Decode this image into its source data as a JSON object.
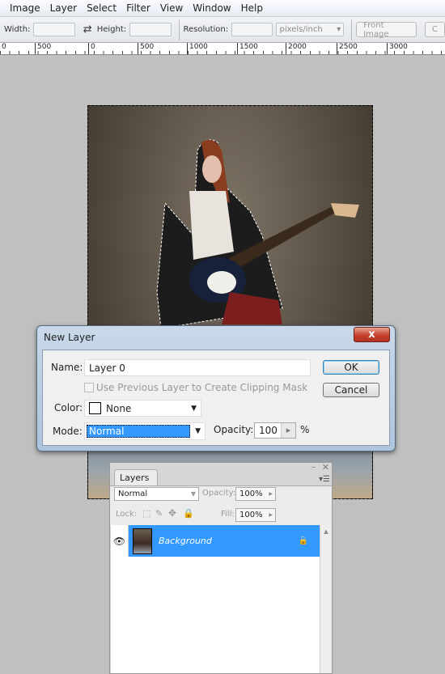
{
  "menu": [
    "Image",
    "Layer",
    "Select",
    "Filter",
    "View",
    "Window",
    "Help"
  ],
  "options": {
    "width_label": "Width:",
    "height_label": "Height:",
    "resolution_label": "Resolution:",
    "units": "pixels/inch",
    "front_image": "Front Image",
    "clear": "C"
  },
  "ruler": [
    "0",
    "500",
    "0",
    "500",
    "1000",
    "1500",
    "2000",
    "2500",
    "3000"
  ],
  "dialog": {
    "title": "New Layer",
    "close": "x",
    "name_label": "Name:",
    "name_value": "Layer 0",
    "clipping_label": "Use Previous Layer to Create Clipping Mask",
    "color_label": "Color:",
    "color_value": "None",
    "mode_label": "Mode:",
    "mode_value": "Normal",
    "opacity_label": "Opacity:",
    "opacity_value": "100",
    "percent": "%",
    "ok": "OK",
    "cancel": "Cancel"
  },
  "layers_panel": {
    "tab": "Layers",
    "tab_close": "×",
    "blend_mode": "Normal",
    "opacity_label": "Opacity:",
    "opacity_value": "100%",
    "lock_label": "Lock:",
    "fill_label": "Fill:",
    "fill_value": "100%",
    "layers": [
      {
        "name": "Background",
        "visible": true,
        "locked": true
      }
    ]
  },
  "colors": {
    "selection": "#3399ff",
    "dialog_frame": "#aec4dc",
    "canvas_bg": "#c0c0c0"
  }
}
